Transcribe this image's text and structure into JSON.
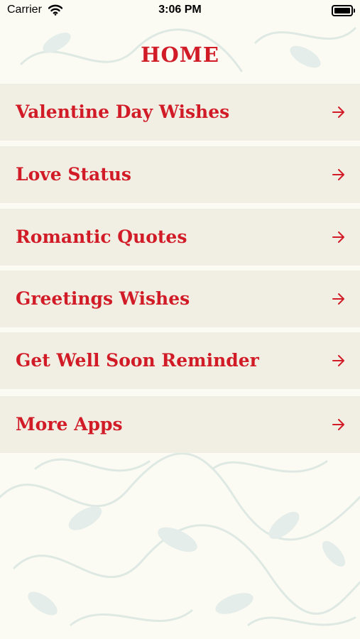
{
  "status_bar": {
    "carrier": "Carrier",
    "time": "3:06 PM",
    "icons": [
      "wifi-icon",
      "battery-icon"
    ]
  },
  "page": {
    "title": "HOME"
  },
  "menu": {
    "items": [
      {
        "label": "Valentine Day Wishes",
        "icon": "arrow-right-icon"
      },
      {
        "label": "Love Status",
        "icon": "arrow-right-icon"
      },
      {
        "label": "Romantic Quotes",
        "icon": "arrow-right-icon"
      },
      {
        "label": "Greetings Wishes",
        "icon": "arrow-right-icon"
      },
      {
        "label": "Get Well Soon Reminder",
        "icon": "arrow-right-icon"
      },
      {
        "label": "More Apps",
        "icon": "arrow-right-icon"
      }
    ]
  },
  "colors": {
    "accent": "#d11c28",
    "item_background": "#f1efe4",
    "page_background": "#fbfbf3"
  }
}
